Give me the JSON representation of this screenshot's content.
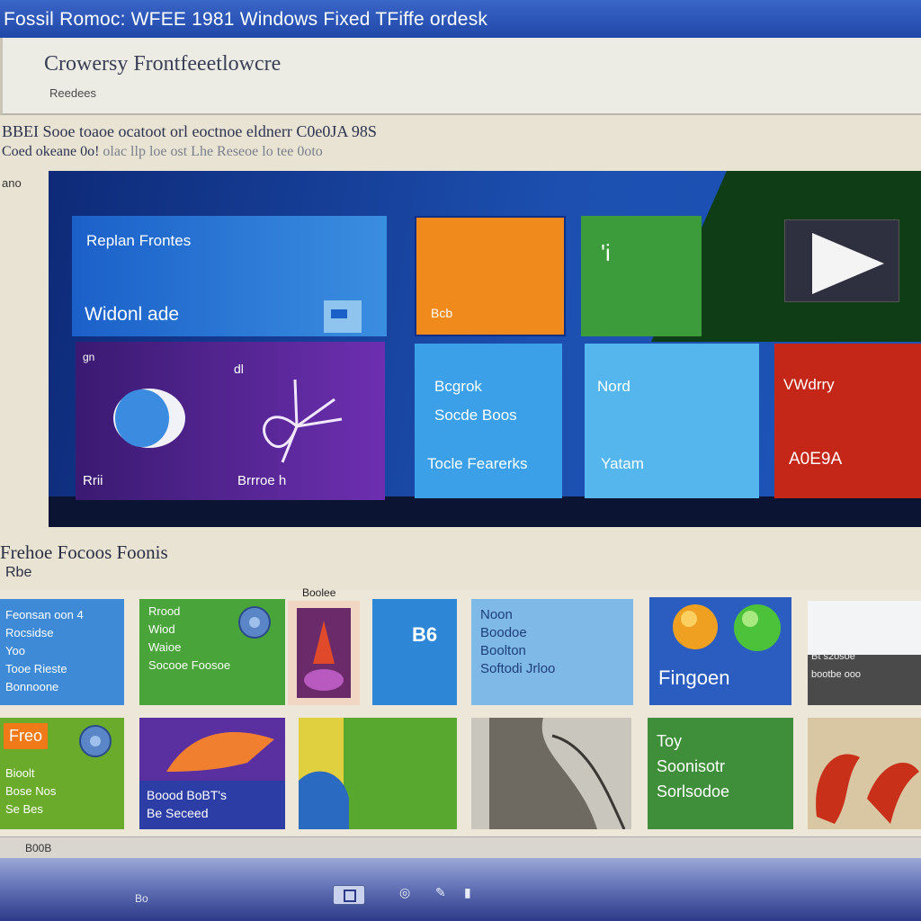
{
  "window": {
    "title": "Fossil Romoc: WFEE 1981 Windows Fixed TFiffe ordesk"
  },
  "header": {
    "heading": "Crowersy Frontfeeetlowcre",
    "sub": "Reedees"
  },
  "info": {
    "line1": "BBEI Sooe toaoe ocatoot orl eoctnoe eldnerr C0e0JA 98S",
    "line2_strong": "Coed okeane 0o!",
    "line2_dim": "olac llp loe ost Lhe Reseoe lo tee 0oto",
    "side_label": "ano"
  },
  "start_tiles": {
    "blue": {
      "top": "Replan Frontes",
      "bottom": "Widonl ade"
    },
    "orange": {
      "label": "Bcb"
    },
    "green": {
      "label": "'i"
    },
    "purple": {
      "tl": "gn",
      "mid": "dl",
      "bottom_left": "Rrii",
      "bottom_right": "Brrroe h"
    },
    "sky1": {
      "l1": "Bcgrok",
      "l2": "Socde Boos",
      "l3": "Tocle Fearerks"
    },
    "sky2": {
      "l1": "Nord",
      "l2": "Yatam"
    },
    "red": {
      "l1": "VWdrry",
      "l2": "A0E9A"
    }
  },
  "featured": {
    "title": "Frehoe Focoos Foonis",
    "sub": "Rbe"
  },
  "apps": {
    "a1": "Feonsan oon 4\nRocsidse\nYoo\nTooe Rieste\nBonnoone",
    "a2": "Rrood\nWiod\nWaioe\nSocooe Foosoe",
    "a3_label": "Boolee",
    "a4": "B6",
    "a5": "Noon\nBoodoe\nBoolton\nSoftodi Jrloo",
    "a6": "Fingoen",
    "a7": "Bt s2osoe\nbootbe ooo",
    "b1_badge": "Freo",
    "b1": "Bioolt\nBose Nos\nSe Bes",
    "b2": "Boood BoBT's\nBe Seceed",
    "b5": "Toy\nSoonisotr\nSorlsodoe"
  },
  "status": {
    "text": "B00B"
  },
  "taskbar": {
    "label": "Bo"
  },
  "colors": {
    "title_bar": "#1f47a8",
    "tile_blue": "#1b60c9",
    "tile_orange": "#f08a1c",
    "tile_green": "#3c9b3a",
    "tile_purple": "#6d2fb0",
    "tile_red": "#c42718"
  },
  "icons": [
    "play-icon",
    "globe-icon",
    "fan-icon",
    "mail-icon",
    "orange-ball-icon",
    "green-ball-icon",
    "edit-icon",
    "close-icon"
  ]
}
